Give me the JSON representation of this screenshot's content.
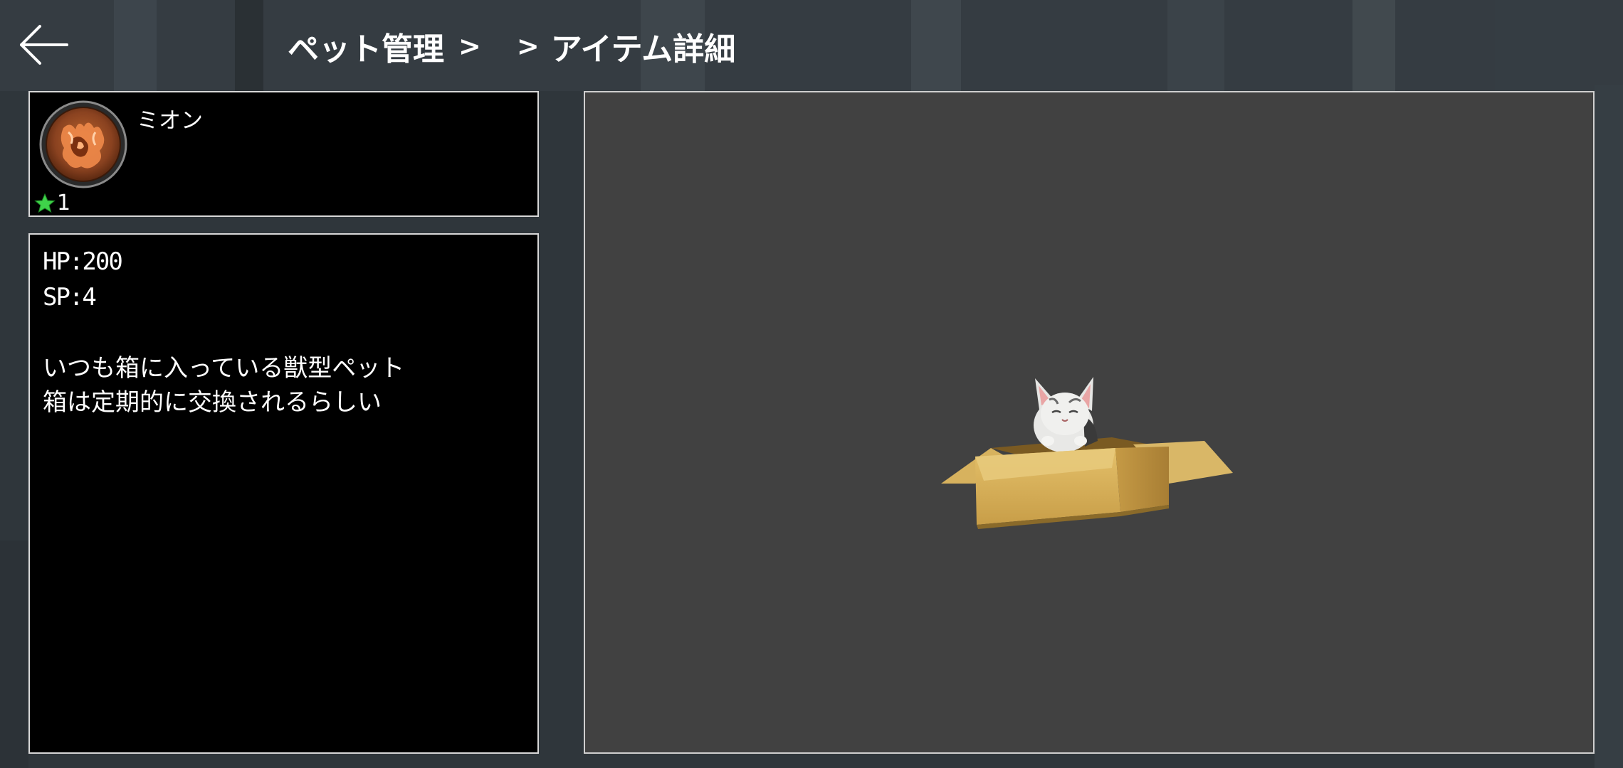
{
  "header": {
    "back_label": "",
    "breadcrumb": {
      "crumb1": "ペット管理",
      "sep1": ">",
      "sep2": ">",
      "crumb2": "アイテム詳細"
    }
  },
  "pet": {
    "name": "ミオン",
    "rarity_icon": "green-star-icon",
    "rarity_count": "1",
    "icon": "fox-emblem-icon"
  },
  "stats": {
    "hp": "HP:200",
    "sp": "SP:4",
    "description_lines": [
      "いつも箱に入っている獣型ペット",
      "箱は定期的に交換されるらしい"
    ]
  },
  "preview": {
    "model": "cat-in-box-model"
  },
  "colors": {
    "panel_bg": "#000000",
    "panel_border": "#d8d8d8",
    "preview_bg": "#414141",
    "star": "#3fd34a",
    "text": "#ffffff"
  }
}
